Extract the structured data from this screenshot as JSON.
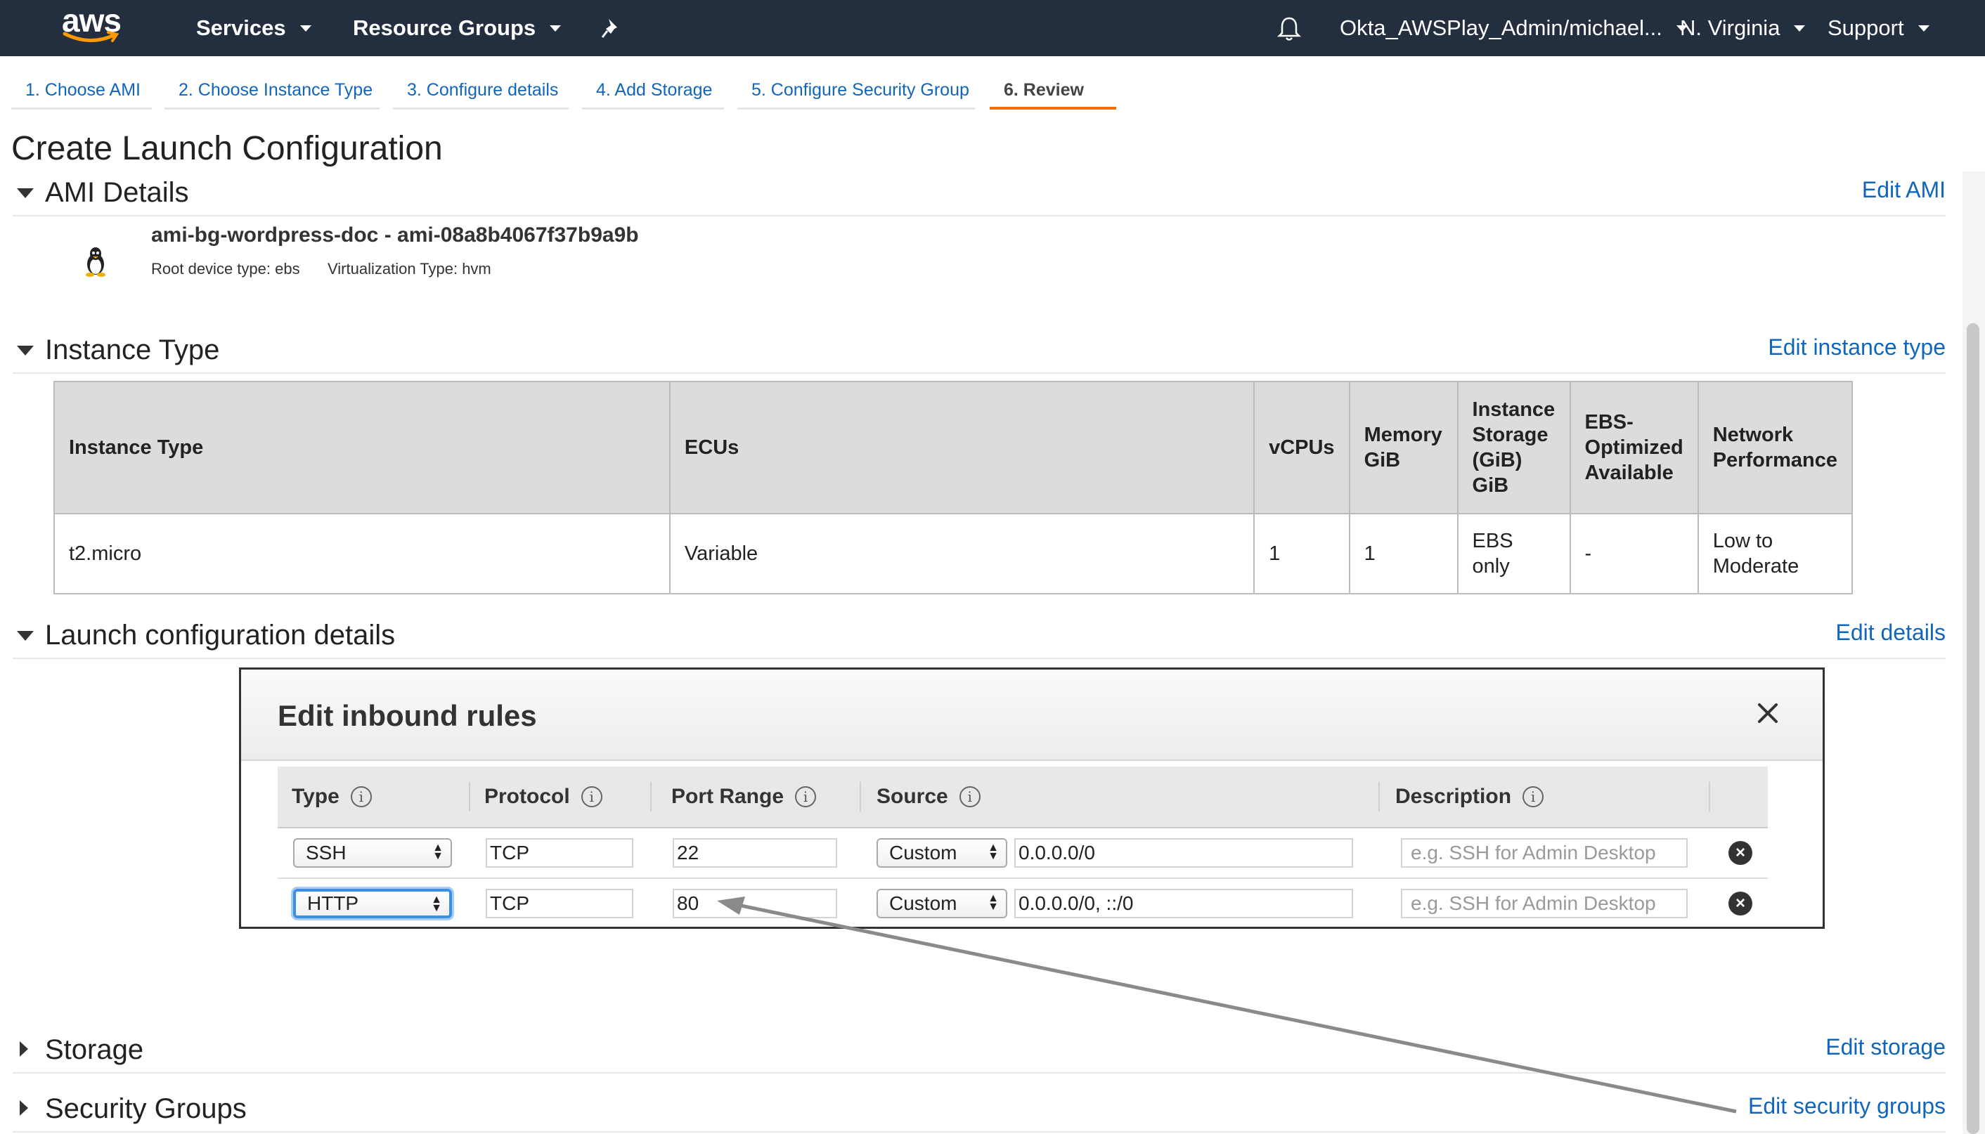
{
  "topnav": {
    "logo": "aws",
    "services": "Services",
    "resource_groups": "Resource Groups",
    "pin_icon": "pin-icon",
    "bell_icon": "bell-icon",
    "account": "Okta_AWSPlay_Admin/michael...",
    "region": "N. Virginia",
    "support": "Support"
  },
  "wizard_tabs": [
    {
      "label": "1. Choose AMI"
    },
    {
      "label": "2. Choose Instance Type"
    },
    {
      "label": "3. Configure details"
    },
    {
      "label": "4. Add Storage"
    },
    {
      "label": "5. Configure Security Group"
    },
    {
      "label": "6. Review",
      "active": true
    }
  ],
  "page_title": "Create Launch Configuration",
  "sections": {
    "ami": {
      "title": "AMI Details",
      "edit": "Edit AMI",
      "name": "ami-bg-wordpress-doc - ami-08a8b4067f37b9a9b",
      "root_device": "Root device type: ebs",
      "virtualization": "Virtualization Type: hvm",
      "icon": "linux-penguin-icon"
    },
    "instance_type": {
      "title": "Instance Type",
      "edit": "Edit instance type",
      "headers": [
        "Instance Type",
        "ECUs",
        "vCPUs",
        "Memory GiB",
        "Instance Storage (GiB) GiB",
        "EBS-Optimized Available",
        "Network Performance"
      ],
      "row": [
        "t2.micro",
        "Variable",
        "1",
        "1",
        "EBS only",
        "-",
        "Low to Moderate"
      ]
    },
    "launch_config": {
      "title": "Launch configuration details",
      "edit": "Edit details"
    },
    "storage": {
      "title": "Storage",
      "edit": "Edit storage"
    },
    "security_groups": {
      "title": "Security Groups",
      "edit": "Edit security groups"
    }
  },
  "modal": {
    "title": "Edit inbound rules",
    "close_icon": "close-icon",
    "columns": [
      "Type",
      "Protocol",
      "Port Range",
      "Source",
      "Description"
    ],
    "rules": [
      {
        "type": "SSH",
        "protocol": "TCP",
        "port": "22",
        "source_mode": "Custom",
        "source": "0.0.0.0/0",
        "description_placeholder": "e.g. SSH for Admin Desktop"
      },
      {
        "type": "HTTP",
        "protocol": "TCP",
        "port": "80",
        "source_mode": "Custom",
        "source": "0.0.0.0/0, ::/0",
        "description_placeholder": "e.g. SSH for Admin Desktop"
      }
    ]
  },
  "colors": {
    "nav_bg": "#232f3e",
    "link": "#1166bb",
    "active_tab": "#ec7211",
    "focus": "#3b8fe8"
  }
}
